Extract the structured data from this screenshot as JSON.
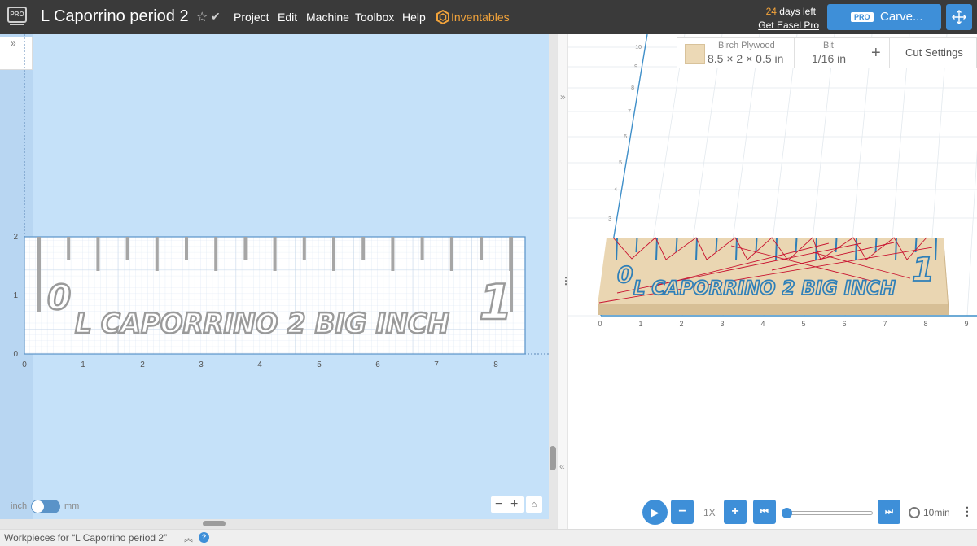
{
  "app": {
    "logo_text": "PRO",
    "project_title": "L Caporrino period 2",
    "menu": [
      "Project",
      "Edit",
      "Machine",
      "Toolbox",
      "Help"
    ],
    "inventables": "Inventables",
    "trial_days": "24",
    "trial_suffix": "days left",
    "get_pro": "Get Easel Pro",
    "carve_badge": "PRO",
    "carve_label": "Carve..."
  },
  "workspace": {
    "y_ticks": [
      "2",
      "1",
      "0"
    ],
    "x_ticks": [
      "0",
      "1",
      "2",
      "3",
      "4",
      "5",
      "6",
      "7",
      "8"
    ],
    "design_text": "L CAPORRINO 2 BIG INCH",
    "ruler_start": "0",
    "ruler_end": "1",
    "unit_left": "inch",
    "unit_right": "mm",
    "unit_selected": "inch",
    "zoom_out": "−",
    "zoom_in": "+"
  },
  "material": {
    "name": "Birch Plywood",
    "dimensions": "8.5 × 2 × 0.5 in",
    "bit_label": "Bit",
    "bit_value": "1/16 in",
    "add": "+",
    "cut_settings": "Cut Settings",
    "swatch_color": "#ecd9b6"
  },
  "preview": {
    "x_ticks": [
      "0",
      "1",
      "2",
      "3",
      "4",
      "5",
      "6",
      "7",
      "8",
      "9"
    ],
    "y_ticks": [
      "3",
      "4",
      "5",
      "6",
      "7",
      "8",
      "9",
      "10"
    ],
    "design_text": "L CAPORRINO 2 BIG INCH",
    "ruler_start": "0",
    "ruler_end": "1"
  },
  "simulation": {
    "speed": "1X",
    "progress": 0,
    "time": "10min"
  },
  "footer": {
    "workpieces": "Workpieces for “L Caporrino period 2”",
    "help": "?"
  },
  "colors": {
    "topbar": "#3a3a3a",
    "accent": "#3e8fd8",
    "orange": "#f2a33a",
    "canvas_bg": "#c5e1f9",
    "toolpath": "#2e7fb8",
    "travel": "#c8102e"
  }
}
